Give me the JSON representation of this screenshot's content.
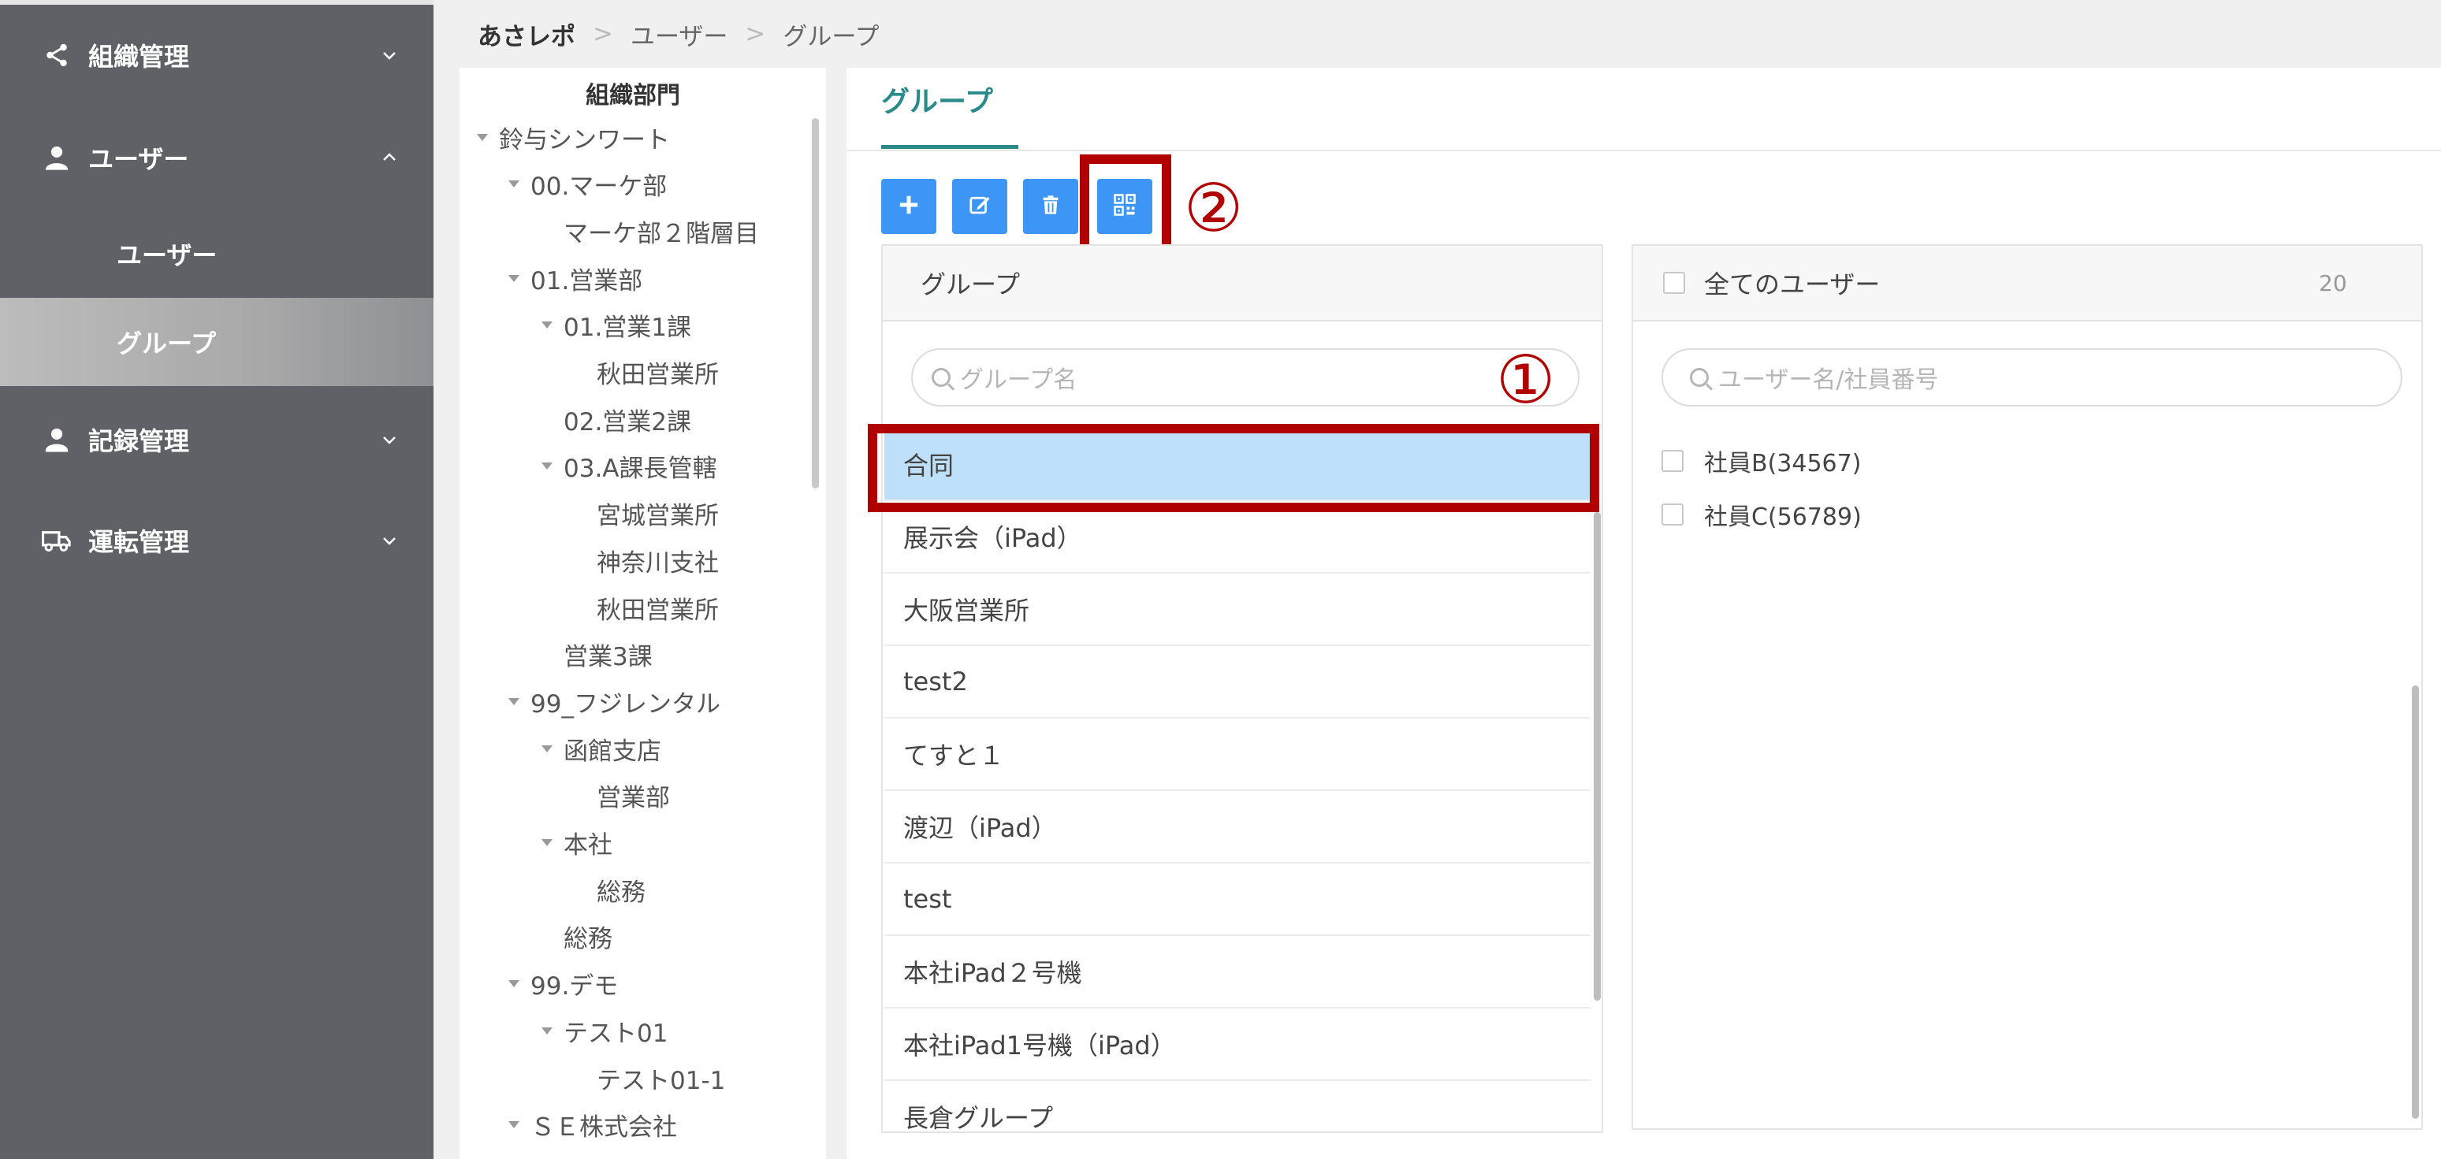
{
  "breadcrumb": {
    "home": "あさレポ",
    "sep1": ">",
    "item1": "ユーザー",
    "sep2": ">",
    "item2": "グループ"
  },
  "sidebar": {
    "items": [
      {
        "label": "組織管理",
        "icon": "share-icon",
        "expanded": false
      },
      {
        "label": "ユーザー",
        "icon": "user-icon",
        "expanded": true
      },
      {
        "label": "記録管理",
        "icon": "user-record-icon",
        "expanded": false
      },
      {
        "label": "運転管理",
        "icon": "truck-icon",
        "expanded": false
      }
    ],
    "sub_items": [
      {
        "label": "ユーザー",
        "active": false
      },
      {
        "label": "グループ",
        "active": true
      }
    ]
  },
  "tree": {
    "title": "組織部門",
    "nodes": [
      {
        "label": "鈴与シンワート",
        "level": 0,
        "caret": true
      },
      {
        "label": "00.マーケ部",
        "level": 1,
        "caret": true
      },
      {
        "label": "マーケ部２階層目",
        "level": 2,
        "caret": false
      },
      {
        "label": "01.営業部",
        "level": 1,
        "caret": true
      },
      {
        "label": "01.営業1課",
        "level": 2,
        "caret": true
      },
      {
        "label": "秋田営業所",
        "level": 3,
        "caret": false
      },
      {
        "label": "02.営業2課",
        "level": 2,
        "caret": false
      },
      {
        "label": "03.A課長管轄",
        "level": 2,
        "caret": true
      },
      {
        "label": "宮城営業所",
        "level": 3,
        "caret": false
      },
      {
        "label": "神奈川支社",
        "level": 3,
        "caret": false
      },
      {
        "label": "秋田営業所",
        "level": 3,
        "caret": false
      },
      {
        "label": "営業3課",
        "level": 2,
        "caret": false
      },
      {
        "label": "99_フジレンタル",
        "level": 1,
        "caret": true
      },
      {
        "label": "函館支店",
        "level": 2,
        "caret": true
      },
      {
        "label": "営業部",
        "level": 3,
        "caret": false
      },
      {
        "label": "本社",
        "level": 2,
        "caret": true
      },
      {
        "label": "総務",
        "level": 3,
        "caret": false
      },
      {
        "label": "総務",
        "level": 2,
        "caret": false
      },
      {
        "label": "99.デモ",
        "level": 1,
        "caret": true
      },
      {
        "label": "テスト01",
        "level": 2,
        "caret": true
      },
      {
        "label": "テスト01-1",
        "level": 3,
        "caret": false
      },
      {
        "label": "ＳＥ株式会社",
        "level": 1,
        "caret": true
      }
    ]
  },
  "tab": {
    "label": "グループ"
  },
  "toolbar": {
    "buttons": [
      {
        "name": "add-button",
        "icon": "plus-icon"
      },
      {
        "name": "edit-button",
        "icon": "edit-icon"
      },
      {
        "name": "delete-button",
        "icon": "trash-icon"
      },
      {
        "name": "qr-button",
        "icon": "qr-code-icon"
      }
    ],
    "colors": {
      "button": "#3d95f5",
      "annotation": "#b00000",
      "accent": "#2a8a8a"
    }
  },
  "annotations": {
    "marker1": "①",
    "marker2": "②"
  },
  "group_panel": {
    "header": "グループ",
    "search_placeholder": "グループ名",
    "groups": [
      "合同",
      "展示会（iPad）",
      "大阪営業所",
      "test2",
      "てすと１",
      "渡辺（iPad）",
      "test",
      "本社iPad２号機",
      "本社iPad1号機（iPad）",
      "長倉グループ"
    ],
    "selected_index": 0
  },
  "user_panel": {
    "header": "全てのユーザー",
    "count": "20",
    "search_placeholder": "ユーザー名/社員番号",
    "users": [
      "社員B(34567)",
      "社員C(56789)"
    ]
  }
}
